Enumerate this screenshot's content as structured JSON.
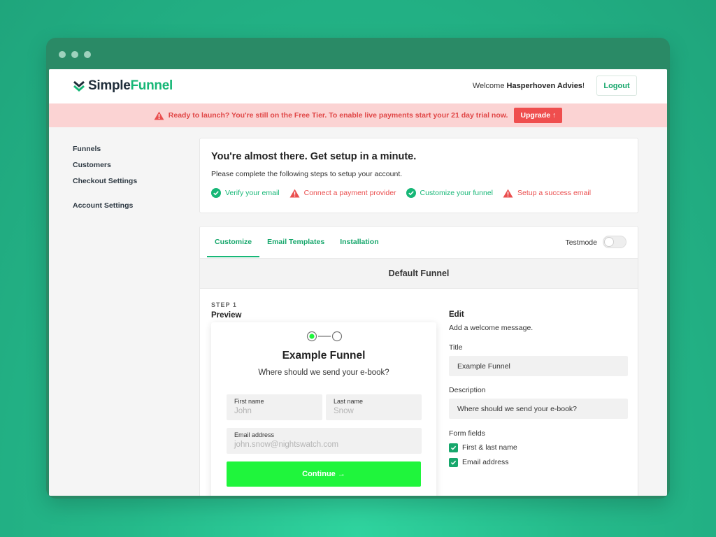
{
  "brand": {
    "simple": "Simple",
    "funnel": "Funnel"
  },
  "header": {
    "welcome_prefix": "Welcome ",
    "user_name": "Hasperhoven Advies",
    "welcome_suffix": "!",
    "logout_label": "Logout"
  },
  "banner": {
    "text": "Ready to launch? You're still on the Free Tier. To enable live payments start your 21 day trial now.",
    "upgrade_label": "Upgrade ↑"
  },
  "sidebar": {
    "items": [
      {
        "label": "Funnels"
      },
      {
        "label": "Customers"
      },
      {
        "label": "Checkout Settings"
      },
      {
        "label": "Account Settings"
      }
    ]
  },
  "setup": {
    "title": "You're almost there. Get setup in a minute.",
    "subtitle": "Please complete the following steps to setup your account.",
    "steps": [
      {
        "label": "Verify your email",
        "status": "done"
      },
      {
        "label": "Connect a payment provider",
        "status": "warning"
      },
      {
        "label": "Customize your funnel",
        "status": "done"
      },
      {
        "label": "Setup a success email",
        "status": "warning"
      }
    ]
  },
  "tabs": [
    {
      "label": "Customize",
      "active": true
    },
    {
      "label": "Email Templates"
    },
    {
      "label": "Installation"
    }
  ],
  "testmode": {
    "label": "Testmode",
    "enabled": false
  },
  "funnel": {
    "name": "Default Funnel",
    "step_label": "STEP 1",
    "preview_label": "Preview"
  },
  "preview": {
    "title": "Example Funnel",
    "subtitle": "Where should we send your e-book?",
    "first_name": {
      "label": "First name",
      "placeholder": "John"
    },
    "last_name": {
      "label": "Last name",
      "placeholder": "Snow"
    },
    "email": {
      "label": "Email address",
      "placeholder": "john.snow@nightswatch.com"
    },
    "continue_label": "Continue →"
  },
  "edit": {
    "heading": "Edit",
    "subtitle": "Add a welcome message.",
    "title_label": "Title",
    "title_value": "Example Funnel",
    "description_label": "Description",
    "description_value": "Where should we send your e-book?",
    "form_fields_label": "Form fields",
    "fields": [
      {
        "label": "First & last name",
        "checked": true
      },
      {
        "label": "Email address",
        "checked": true
      }
    ]
  },
  "colors": {
    "accent": "#17b777",
    "warning": "#ea4e4e",
    "banner_bg": "#fbd3d3",
    "cta": "#1ff53c"
  }
}
